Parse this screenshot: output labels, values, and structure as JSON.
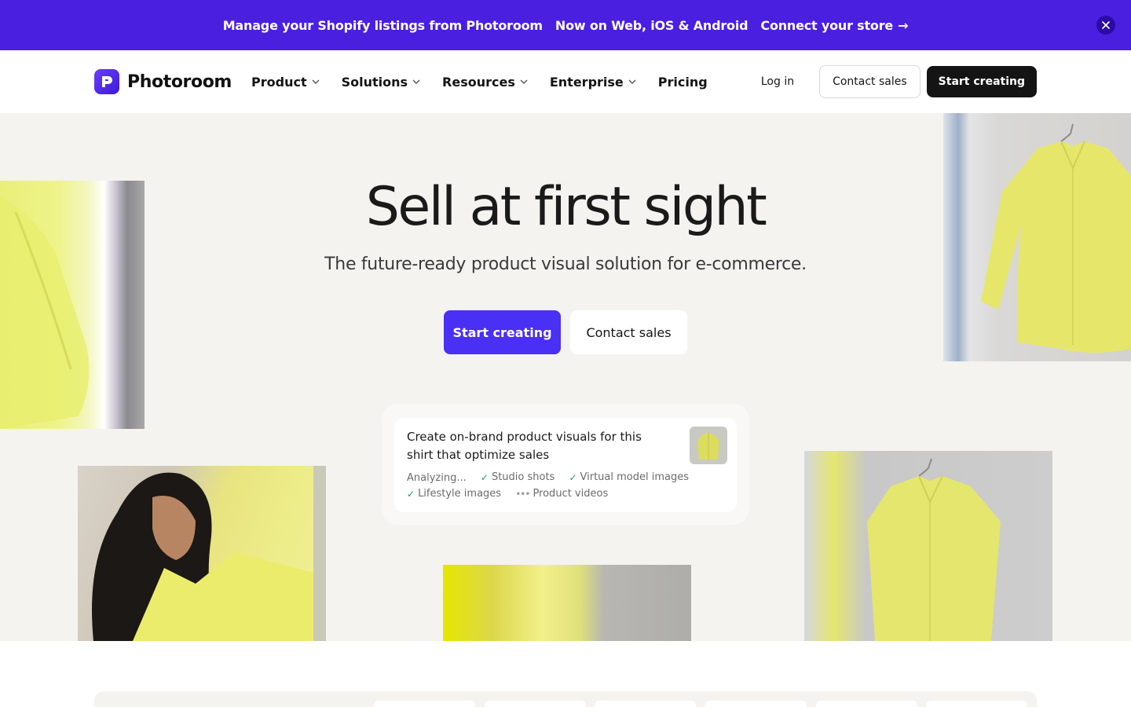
{
  "banner": {
    "text_1": "Manage your Shopify listings from Photoroom",
    "text_2": "Now on Web, iOS & Android",
    "cta": "Connect your store",
    "cta_arrow": "→",
    "bg": "#4a1fe0"
  },
  "nav": {
    "brand": "Photoroom",
    "items": [
      {
        "label": "Product",
        "has_dropdown": true
      },
      {
        "label": "Solutions",
        "has_dropdown": true
      },
      {
        "label": "Resources",
        "has_dropdown": true
      },
      {
        "label": "Enterprise",
        "has_dropdown": true
      },
      {
        "label": "Pricing",
        "has_dropdown": false
      }
    ],
    "login": "Log in",
    "contact_sales": "Contact sales",
    "start_creating": "Start creating"
  },
  "hero": {
    "title": "Sell at first sight",
    "subtitle": "The future-ready product visual solution for e-commerce.",
    "primary_cta": "Start creating",
    "secondary_cta": "Contact sales",
    "accent": "#4a2ff5"
  },
  "card": {
    "prompt": "Create on-brand product visuals for this shirt that optimize sales",
    "status": "Analyzing...",
    "tags": [
      {
        "label": "Studio shots",
        "state": "done"
      },
      {
        "label": "Virtual model images",
        "state": "done"
      },
      {
        "label": "Lifestyle images",
        "state": "done"
      },
      {
        "label": "Product videos",
        "state": "pending"
      }
    ]
  },
  "icons": {
    "close": "close-icon",
    "chevron": "chevron-down-icon",
    "check": "check-icon",
    "logo": "photoroom-logo-icon"
  }
}
